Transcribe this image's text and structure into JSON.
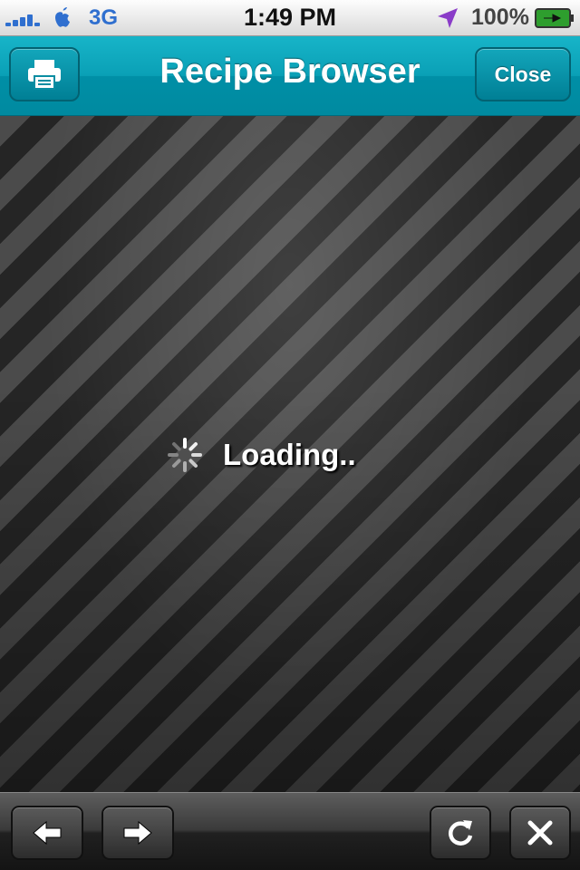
{
  "status_bar": {
    "carrier": "3G",
    "time": "1:49 PM",
    "battery": "100%"
  },
  "nav": {
    "title": "Recipe Browser",
    "close_label": "Close"
  },
  "content": {
    "loading_text": "Loading.."
  },
  "toolbar": {
    "back_icon": "left-arrow-icon",
    "forward_icon": "right-arrow-icon",
    "reload_icon": "reload-icon",
    "stop_icon": "x-icon"
  },
  "colors": {
    "nav_accent": "#0aa0b6",
    "status_blue": "#2f6fcf"
  }
}
